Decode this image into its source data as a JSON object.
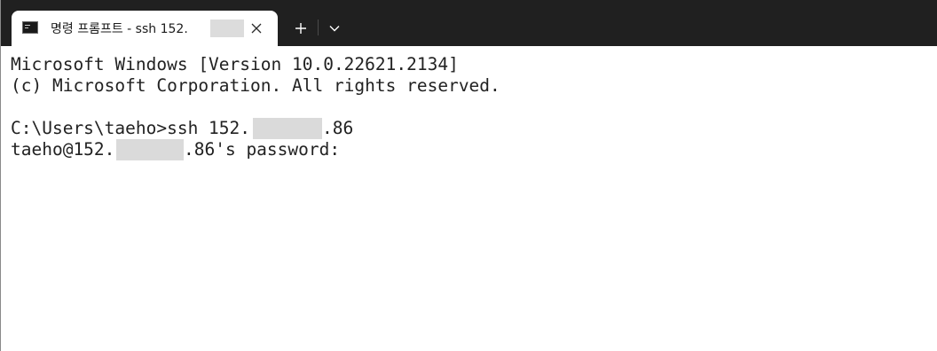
{
  "tab": {
    "icon": "command-prompt-icon",
    "title": "명령 프롬프트 - ssh  152."
  },
  "toolbar": {
    "close_icon": "close-icon",
    "new_tab_icon": "plus-icon",
    "dropdown_icon": "chevron-down-icon"
  },
  "terminal": {
    "lines": [
      "Microsoft Windows [Version 10.0.22621.2134]",
      "(c) Microsoft Corporation. All rights reserved.",
      "",
      "C:\\Users\\taeho>ssh 152.",
      "taeho@152."
    ],
    "line4_suffix": ".86",
    "line5_suffix": ".86's password:"
  },
  "colors": {
    "tabbar_bg": "#202020",
    "tab_bg": "#ffffff",
    "terminal_bg": "#ffffff",
    "terminal_text": "#222222"
  }
}
